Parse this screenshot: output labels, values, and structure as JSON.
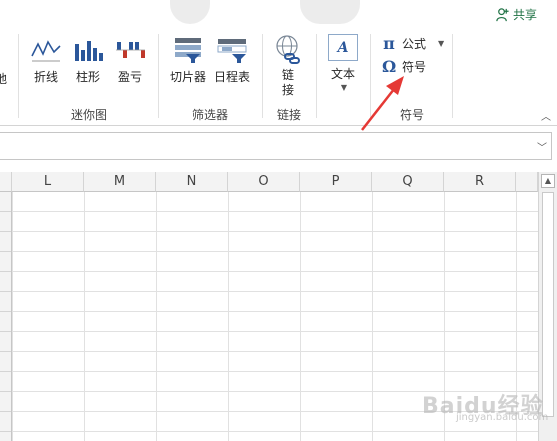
{
  "titlebar": {
    "share_label": "共享"
  },
  "ribbon": {
    "partial_label": "地",
    "sparklines": {
      "group_label": "迷你图",
      "items": [
        {
          "label": "折线",
          "icon": "sparkline-line-icon"
        },
        {
          "label": "柱形",
          "icon": "sparkline-column-icon"
        },
        {
          "label": "盈亏",
          "icon": "sparkline-winloss-icon"
        }
      ]
    },
    "filters": {
      "group_label": "筛选器",
      "items": [
        {
          "label": "切片器",
          "icon": "slicer-icon"
        },
        {
          "label": "日程表",
          "icon": "timeline-icon"
        }
      ]
    },
    "links": {
      "group_label": "链接",
      "items": [
        {
          "label_line1": "链",
          "label_line2": "接",
          "icon": "hyperlink-icon"
        }
      ]
    },
    "text": {
      "label": "文本",
      "icon": "textbox-icon"
    },
    "symbols": {
      "group_label": "符号",
      "equation": {
        "glyph": "π",
        "label": "公式"
      },
      "symbol": {
        "glyph": "Ω",
        "label": "符号"
      }
    }
  },
  "formula_bar": {
    "value": ""
  },
  "columns": [
    "L",
    "M",
    "N",
    "O",
    "P",
    "Q",
    "R"
  ],
  "watermark": {
    "text": "Baidu经验",
    "sub": "jingyan.baidu.com"
  },
  "colors": {
    "accent": "#2b579a",
    "share": "#217346",
    "annotation": "#e53935"
  }
}
